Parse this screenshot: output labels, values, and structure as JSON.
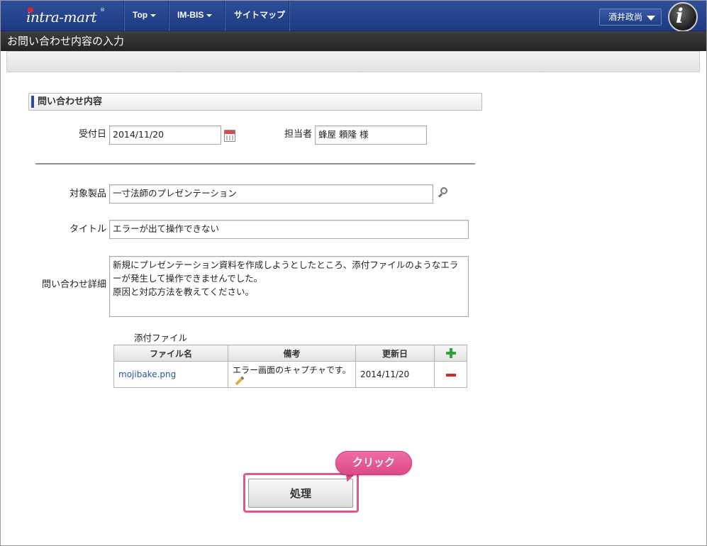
{
  "header": {
    "logo_text": "intra-mart",
    "logo_reg": "®",
    "nav": [
      {
        "label": "Top"
      },
      {
        "label": "IM-BIS"
      },
      {
        "label": "サイトマップ"
      }
    ],
    "user_name": "酒井政尚"
  },
  "page": {
    "title": "お問い合わせ内容の入力"
  },
  "section": {
    "title": "問い合わせ内容"
  },
  "form": {
    "received_date_label": "受付日",
    "received_date_value": "2014/11/20",
    "assignee_label": "担当者",
    "assignee_value": "蜂屋 頼隆 様",
    "product_label": "対象製品",
    "product_value": "一寸法師のプレゼンテーション",
    "title_label": "タイトル",
    "title_value": "エラーが出て操作できない",
    "details_label": "問い合わせ詳細",
    "details_value": "新規にプレゼンテーション資料を作成しようとしたところ、添付ファイルのようなエラーが発生して操作できませんでした。\n原因と対応方法を教えてください。"
  },
  "attachments": {
    "label": "添付ファイル",
    "columns": [
      "ファイル名",
      "備考",
      "更新日"
    ],
    "rows": [
      {
        "file": "mojibake.png",
        "note": "エラー画面のキャプチャです。",
        "date": "2014/11/20"
      }
    ]
  },
  "actions": {
    "process_label": "処理",
    "callout_label": "クリック"
  },
  "colors": {
    "nav_bg": "#2a4a95",
    "title_bg": "#2e2e2e",
    "highlight": "#e0568f",
    "link": "#2a53a8"
  }
}
